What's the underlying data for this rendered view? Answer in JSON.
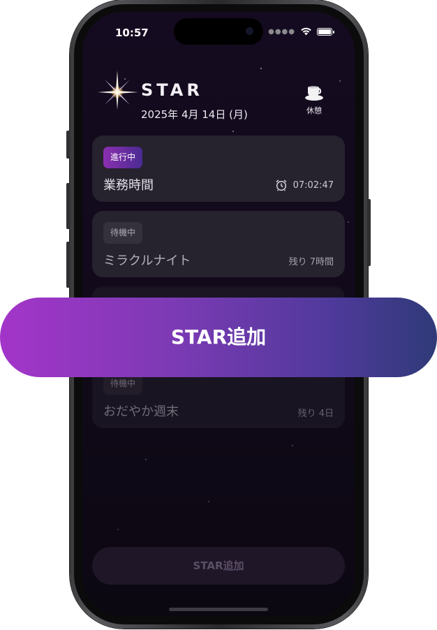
{
  "status_bar": {
    "time": "10:57"
  },
  "header": {
    "title": "STAR",
    "date": "2025年 4月 14日 (月)",
    "rest_label": "休憩"
  },
  "cards": [
    {
      "badge": "進行中",
      "title": "業務時間",
      "right": "07:02:47",
      "icon": "alarm-clock-icon"
    },
    {
      "badge": "待機中",
      "title": "ミラクルナイト",
      "right": "残り 7時間"
    },
    {
      "badge": "待機中",
      "title": "おだやか週末",
      "right": "残り 4日"
    }
  ],
  "add_button": {
    "label": "STAR追加"
  },
  "bottom_button": {
    "label": "STAR追加"
  },
  "colors": {
    "accent_start": "#a335c9",
    "accent_end": "#2f3a78",
    "background": "#150b20"
  }
}
